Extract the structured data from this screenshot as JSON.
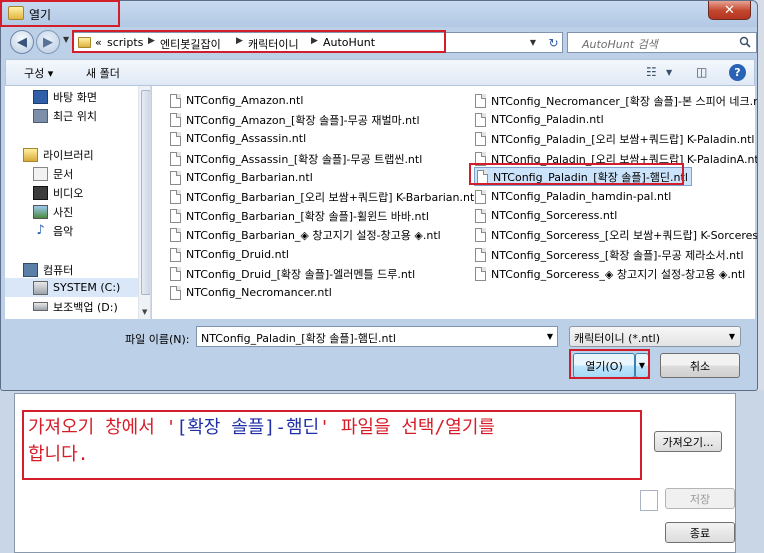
{
  "dialog": {
    "title": "열기",
    "close_symbol": "✕"
  },
  "address_bar": {
    "prefix": "«",
    "segments": [
      "scripts",
      "엔티봇길잡이",
      "캐릭터이니",
      "AutoHunt"
    ]
  },
  "search": {
    "placeholder": "AutoHunt 검색"
  },
  "toolbar": {
    "organize_label": "구성 ▾",
    "new_folder_label": "새 폴더"
  },
  "nav_pane": {
    "items": [
      {
        "label": "바탕 화면",
        "icon": "desktop-icon"
      },
      {
        "label": "최근 위치",
        "icon": "recent-places-icon"
      },
      {
        "label": "라이브러리",
        "icon": "library-icon"
      },
      {
        "label": "문서",
        "icon": "documents-icon"
      },
      {
        "label": "비디오",
        "icon": "videos-icon"
      },
      {
        "label": "사진",
        "icon": "pictures-icon"
      },
      {
        "label": "음악",
        "icon": "music-icon"
      },
      {
        "label": "컴퓨터",
        "icon": "computer-icon"
      },
      {
        "label": "SYSTEM (C:)",
        "icon": "drive-icon"
      },
      {
        "label": "보조백업 (D:)",
        "icon": "drive-icon"
      }
    ]
  },
  "files": {
    "column1": [
      "NTConfig_Amazon.ntl",
      "NTConfig_Amazon_[확장 솔플]-무공 재벌마.ntl",
      "NTConfig_Assassin.ntl",
      "NTConfig_Assassin_[확장 솔플]-무공 트랩씬.ntl",
      "NTConfig_Barbarian.ntl",
      "NTConfig_Barbarian_[오리 보쌈+쿼드랍] K-Barbarian.ntl",
      "NTConfig_Barbarian_[확장 솔플]-휠윈드 바바.ntl",
      "NTConfig_Barbarian_◈ 창고지기 설정-창고용 ◈.ntl",
      "NTConfig_Druid.ntl",
      "NTConfig_Druid_[확장 솔플]-엘러멘틀 드루.ntl",
      "NTConfig_Necromancer.ntl"
    ],
    "column2": [
      "NTConfig_Necromancer_[확장 솔플]-본 스피어 네크.ntl",
      "NTConfig_Paladin.ntl",
      "NTConfig_Paladin_[오리 보쌈+쿼드랍] K-Paladin.ntl",
      "NTConfig_Paladin_[오리 보쌈+쿼드랍] K-PaladinA.ntl",
      "NTConfig_Paladin_[확장 솔플]-햄딘.ntl",
      "NTConfig_Paladin_hamdin-pal.ntl",
      "NTConfig_Sorceress.ntl",
      "NTConfig_Sorceress_[오리 보쌈+쿼드랍] K-Sorceress.ntl",
      "NTConfig_Sorceress_[확장 솔플]-무공 제라소서.ntl",
      "NTConfig_Sorceress_◈ 창고지기 설정-창고용 ◈.ntl"
    ]
  },
  "filename": {
    "label": "파일 이름(N):",
    "value": "NTConfig_Paladin_[확장 솔플]-햄딘.ntl"
  },
  "filter": {
    "value": "캐릭터이니 (*.ntl)"
  },
  "buttons": {
    "open": "열기(O)",
    "cancel": "취소"
  },
  "background": {
    "import_button": "가져오기...",
    "save_button": "저장",
    "exit_button": "종료"
  },
  "callout": {
    "line1_part1": "가져오기 창에서 '",
    "line1_highlight": "[확장 솔플]-햄딘",
    "line1_part2": "' 파일을 선택/열기를",
    "line2": "합니다."
  },
  "colors": {
    "highlight_red": "#d21e2b",
    "callout_text_red": "#d71b27",
    "callout_text_blue": "#1f2fa6",
    "selection_blue": "#cce4fb"
  }
}
